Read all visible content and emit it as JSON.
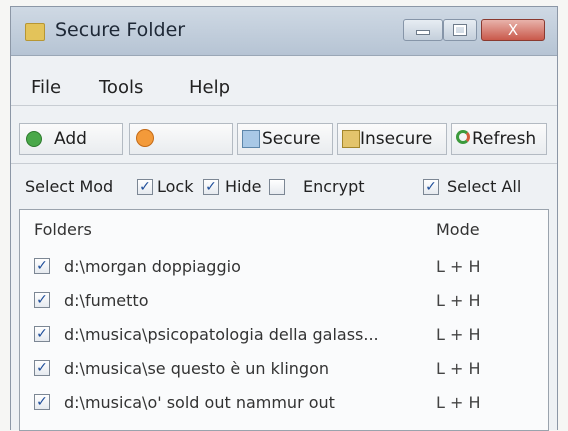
{
  "window": {
    "title": "Secure Folder",
    "close_glyph": "X"
  },
  "menu": {
    "items": [
      "File",
      "Tools",
      "Help"
    ]
  },
  "toolbar": {
    "add_label": "Add",
    "secure_label": "Secure",
    "insecure_label": "Insecure",
    "refresh_label": "Refresh"
  },
  "options": {
    "select_mode_label": "Select Mod",
    "lock_label": "Lock",
    "hide_label": "Hide",
    "encrypt_label": "Encrypt",
    "select_all_label": "Select All",
    "lock_checked": true,
    "hide_checked": false,
    "select_mode_checked": true,
    "select_all_checked": true,
    "check_glyph": "✓"
  },
  "list": {
    "columns": [
      "Folders",
      "Mode"
    ],
    "rows": [
      {
        "path": "d:\\morgan doppiaggio",
        "mode": "L + H",
        "checked": true
      },
      {
        "path": "d:\\fumetto",
        "mode": "L + H",
        "checked": true
      },
      {
        "path": "d:\\musica\\psicopatologia della galass...",
        "mode": "L + H",
        "checked": true
      },
      {
        "path": "d:\\musica\\se questo è un klingon",
        "mode": "L + H",
        "checked": true
      },
      {
        "path": "d:\\musica\\o' sold out nammur out",
        "mode": "L + H",
        "checked": true
      }
    ]
  },
  "icons": {
    "app": "folder-lock-icon",
    "add": "add-icon",
    "globe": "globe-icon",
    "secure": "secure-icon",
    "insecure": "insecure-icon",
    "refresh": "refresh-icon"
  },
  "colors": {
    "check": "#1f4e9a",
    "titlebar": "#c3cfdc",
    "close": "#c9594b"
  }
}
